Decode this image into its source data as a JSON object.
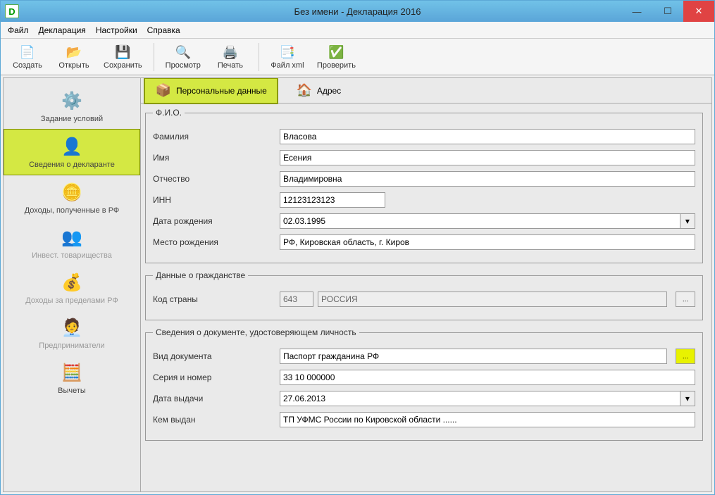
{
  "window": {
    "title": "Без имени - Декларация 2016"
  },
  "menu": {
    "file": "Файл",
    "decl": "Декларация",
    "settings": "Настройки",
    "help": "Справка"
  },
  "toolbar": {
    "create": "Создать",
    "open": "Открыть",
    "save": "Сохранить",
    "preview": "Просмотр",
    "print": "Печать",
    "xml": "Файл xml",
    "check": "Проверить"
  },
  "sidebar": {
    "items": [
      {
        "label": "Задание условий"
      },
      {
        "label": "Сведения о декларанте"
      },
      {
        "label": "Доходы, полученные в РФ"
      },
      {
        "label": "Инвест. товарищества"
      },
      {
        "label": "Доходы за пределами РФ"
      },
      {
        "label": "Предприниматели"
      },
      {
        "label": "Вычеты"
      }
    ]
  },
  "tabs": {
    "personal": "Персональные данные",
    "address": "Адрес"
  },
  "fio": {
    "legend": "Ф.И.О.",
    "surname_label": "Фамилия",
    "surname": "Власова",
    "name_label": "Имя",
    "name": "Есения",
    "patronymic_label": "Отчество",
    "patronymic": "Владимировна",
    "inn_label": "ИНН",
    "inn": "12123123123",
    "dob_label": "Дата рождения",
    "dob": "02.03.1995",
    "birthplace_label": "Место рождения",
    "birthplace": "РФ, Кировская область, г. Киров"
  },
  "citizen": {
    "legend": "Данные о гражданстве",
    "code_label": "Код страны",
    "code": "643",
    "country": "РОССИЯ",
    "browse": "..."
  },
  "doc": {
    "legend": "Сведения о документе, удостоверяющем личность",
    "type_label": "Вид документа",
    "type": "Паспорт гражданина РФ",
    "serial_label": "Серия и номер",
    "serial": "33 10 000000",
    "issue_date_label": "Дата выдачи",
    "issue_date": "27.06.2013",
    "issuer_label": "Кем выдан",
    "issuer": "ТП УФМС России по Кировской области ......",
    "browse": "..."
  }
}
